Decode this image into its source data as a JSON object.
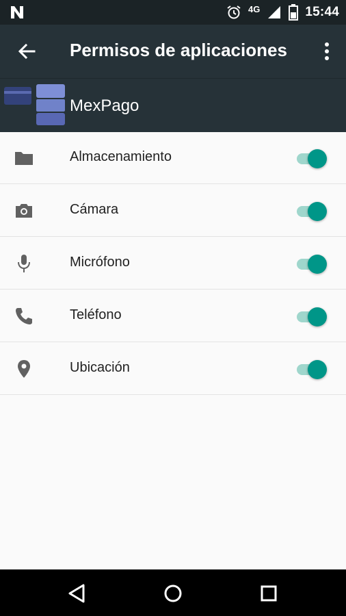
{
  "status_bar": {
    "time": "15:44",
    "network": "4G",
    "icons": [
      "notification-n-icon",
      "alarm-icon",
      "signal-icon",
      "battery-icon"
    ]
  },
  "app_bar": {
    "title": "Permisos de aplicaciones",
    "icons": [
      "back-arrow-icon",
      "more-vert-icon"
    ]
  },
  "app_header": {
    "app_name": "MexPago",
    "icon": "mexpago-logo"
  },
  "permissions": [
    {
      "label": "Almacenamiento",
      "icon": "folder-icon",
      "enabled": true
    },
    {
      "label": "Cámara",
      "icon": "camera-icon",
      "enabled": true
    },
    {
      "label": "Micrófono",
      "icon": "microphone-icon",
      "enabled": true
    },
    {
      "label": "Teléfono",
      "icon": "phone-icon",
      "enabled": true
    },
    {
      "label": "Ubicación",
      "icon": "location-pin-icon",
      "enabled": true
    }
  ],
  "nav_bar": {
    "icons": [
      "back-triangle-icon",
      "home-circle-icon",
      "recents-square-icon"
    ]
  },
  "colors": {
    "status_bar": "#1b2326",
    "app_bar": "#263238",
    "accent": "#009688",
    "accent_track": "#9fd6cc",
    "list_bg": "#fafafa"
  }
}
